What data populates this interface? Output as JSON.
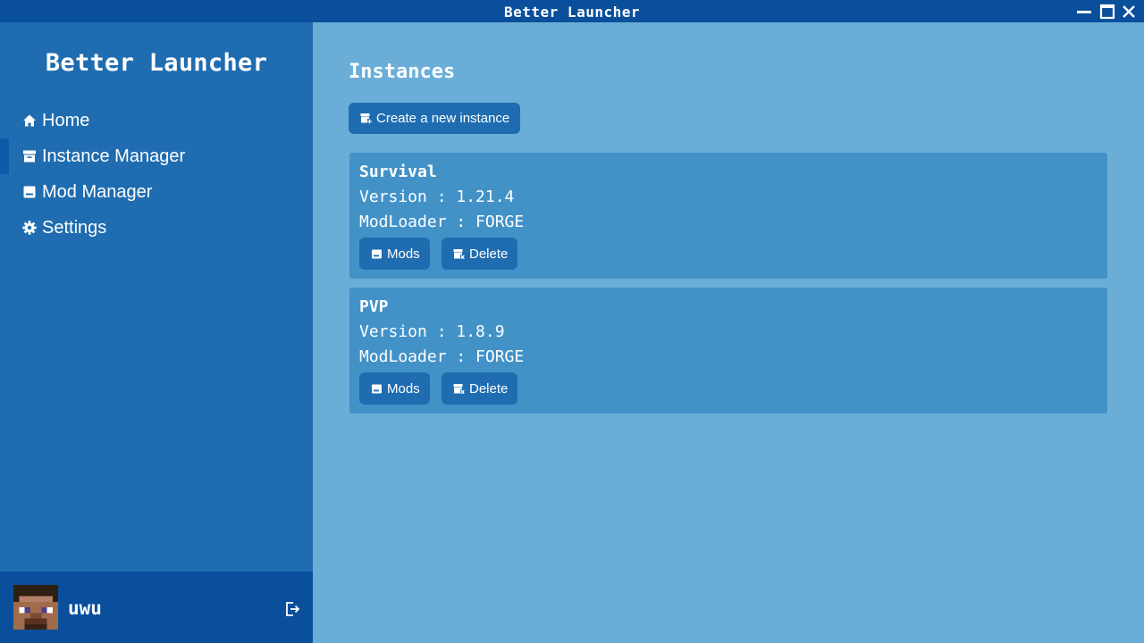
{
  "window": {
    "title": "Better Launcher"
  },
  "sidebar": {
    "brand": "Better Launcher",
    "items": [
      {
        "label": "Home",
        "icon": "home-icon",
        "active": false
      },
      {
        "label": "Instance Manager",
        "icon": "archive-icon",
        "active": true
      },
      {
        "label": "Mod Manager",
        "icon": "box-icon",
        "active": false
      },
      {
        "label": "Settings",
        "icon": "gear-icon",
        "active": false
      }
    ]
  },
  "user": {
    "name": "uwu"
  },
  "main": {
    "title": "Instances",
    "create_label": "Create a new instance",
    "instances": [
      {
        "name": "Survival",
        "version_text": "Version : 1.21.4",
        "loader_text": "ModLoader : FORGE",
        "mods_label": "Mods",
        "delete_label": "Delete"
      },
      {
        "name": "PVP",
        "version_text": "Version : 1.8.9",
        "loader_text": "ModLoader : FORGE",
        "mods_label": "Mods",
        "delete_label": "Delete"
      }
    ]
  },
  "colors": {
    "titlebar": "#0a4f9b",
    "sidebar": "#1f6db0",
    "main_bg": "#6aaed8",
    "card": "#4292c8",
    "button": "#1f6db0"
  }
}
